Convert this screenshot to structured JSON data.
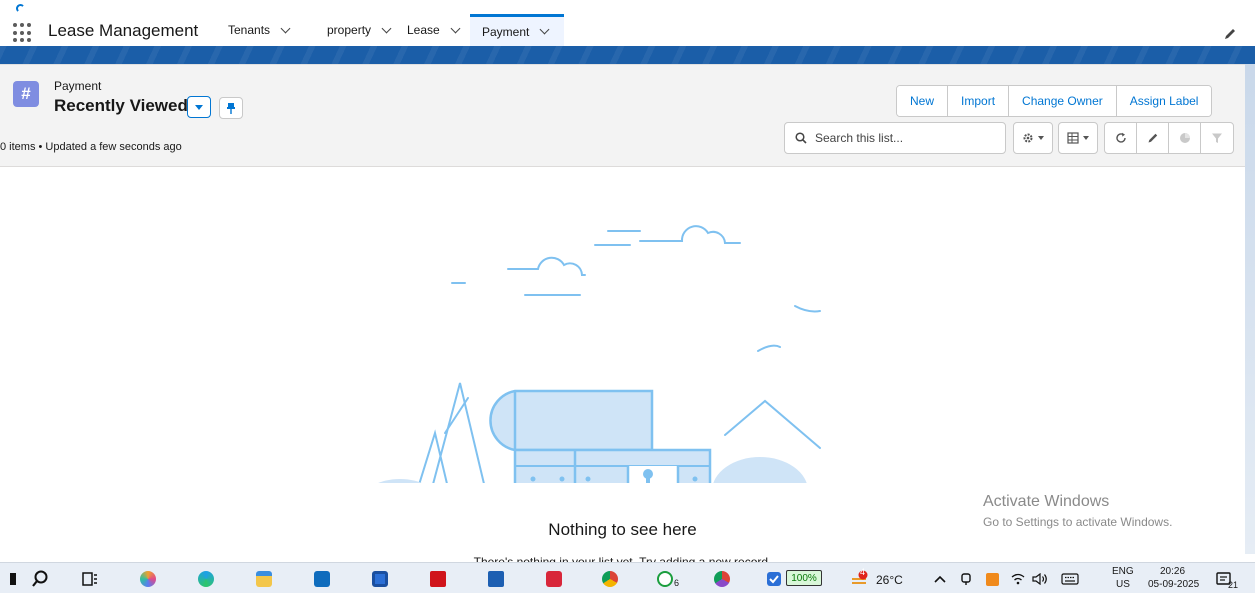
{
  "app": {
    "name": "Lease Management"
  },
  "nav": {
    "tabs": [
      {
        "label": "Tenants",
        "active": false
      },
      {
        "label": "property",
        "active": false
      },
      {
        "label": "Lease",
        "active": false
      },
      {
        "label": "Payment",
        "active": true
      }
    ]
  },
  "list_view": {
    "object_label": "Payment",
    "name": "Recently Viewed",
    "meta": "0 items • Updated a few seconds ago",
    "actions": [
      "New",
      "Import",
      "Change Owner",
      "Assign Label"
    ],
    "search_placeholder": "Search this list..."
  },
  "empty_state": {
    "title": "Nothing to see here",
    "subtitle": "There's nothing in your list yet. Try adding a new record."
  },
  "watermark": {
    "line1": "Activate Windows",
    "line2": "Go to Settings to activate Windows."
  },
  "taskbar": {
    "battery": "100%",
    "temperature": "26°C",
    "weather_badge": "4",
    "whatsapp_badge": "6",
    "language": "ENG",
    "region": "US",
    "time": "20:26",
    "date": "05-09-2025",
    "notifications": "21"
  },
  "colors": {
    "brand_blue": "#0176d3",
    "band_blue": "#1b5ea8",
    "object_icon": "#7f8de1",
    "illustration_stroke": "#7fc1f0",
    "illustration_fill": "#cfe4f7"
  }
}
